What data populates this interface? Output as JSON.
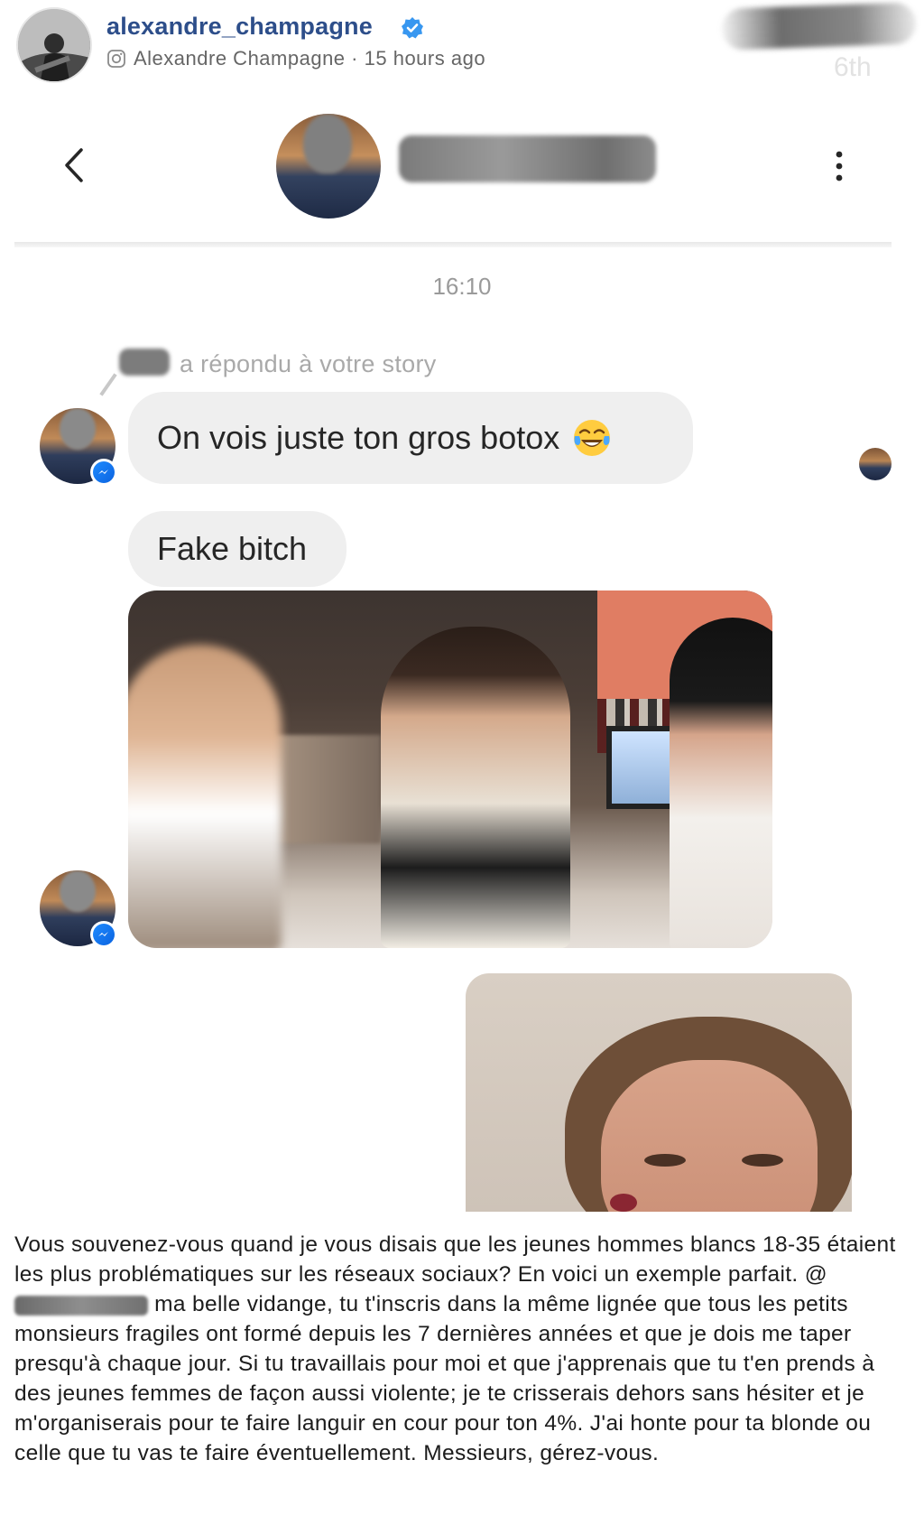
{
  "post": {
    "username": "alexandre_champagne",
    "verified": true,
    "display_name": "Alexandre Champagne",
    "separator": "·",
    "time_ago": "15 hours ago",
    "rank_label": "6th"
  },
  "dm": {
    "timestamp": "16:10",
    "reply_note": "a répondu à votre story",
    "messages": [
      {
        "type": "text",
        "text": "On vois juste ton gros botox",
        "emoji": "face-with-tears-of-joy"
      },
      {
        "type": "text",
        "text": "Fake bitch"
      },
      {
        "type": "gif"
      }
    ],
    "sent": [
      {
        "type": "photo"
      }
    ]
  },
  "caption": {
    "part1": "Vous souvenez-vous quand je vous disais que les jeunes hommes blancs 18-35 étaient les plus problématiques sur les réseaux sociaux? En voici un exemple parfait. @",
    "part2": " ma belle vidange, tu t'inscris dans la même lignée que tous les petits monsieurs fragiles ont formé depuis les 7 dernières années et que je dois me taper presqu'à chaque jour. Si tu travaillais pour moi et que j'apprenais que tu t'en prends à des jeunes femmes de façon aussi violente; je te crisserais dehors sans hésiter et je m'organiserais pour te faire languir en cour pour ton 4%. J'ai honte pour ta blonde ou celle que tu vas te faire éventuellement. Messieurs, gérez-vous."
  },
  "colors": {
    "username": "#2d4e8a",
    "verified": "#3897f0",
    "bubble": "#efefef",
    "messenger": "#1f8bff"
  }
}
